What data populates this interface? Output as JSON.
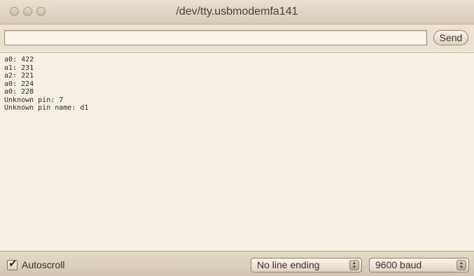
{
  "window": {
    "title": "/dev/tty.usbmodemfa141"
  },
  "input": {
    "value": "",
    "send_label": "Send"
  },
  "output": {
    "lines": [
      "a0: 422",
      "a1: 231",
      "a2: 221",
      "a0: 224",
      "a0: 228",
      "Unknown pin: 7",
      "Unknown pin name: d1"
    ]
  },
  "footer": {
    "autoscroll_label": "Autoscroll",
    "autoscroll_checked": true,
    "line_ending": "No line ending",
    "baud": "9600 baud"
  },
  "icons": {
    "checkmark": "checkmark-icon",
    "stepper": "up-down-arrows-icon"
  }
}
